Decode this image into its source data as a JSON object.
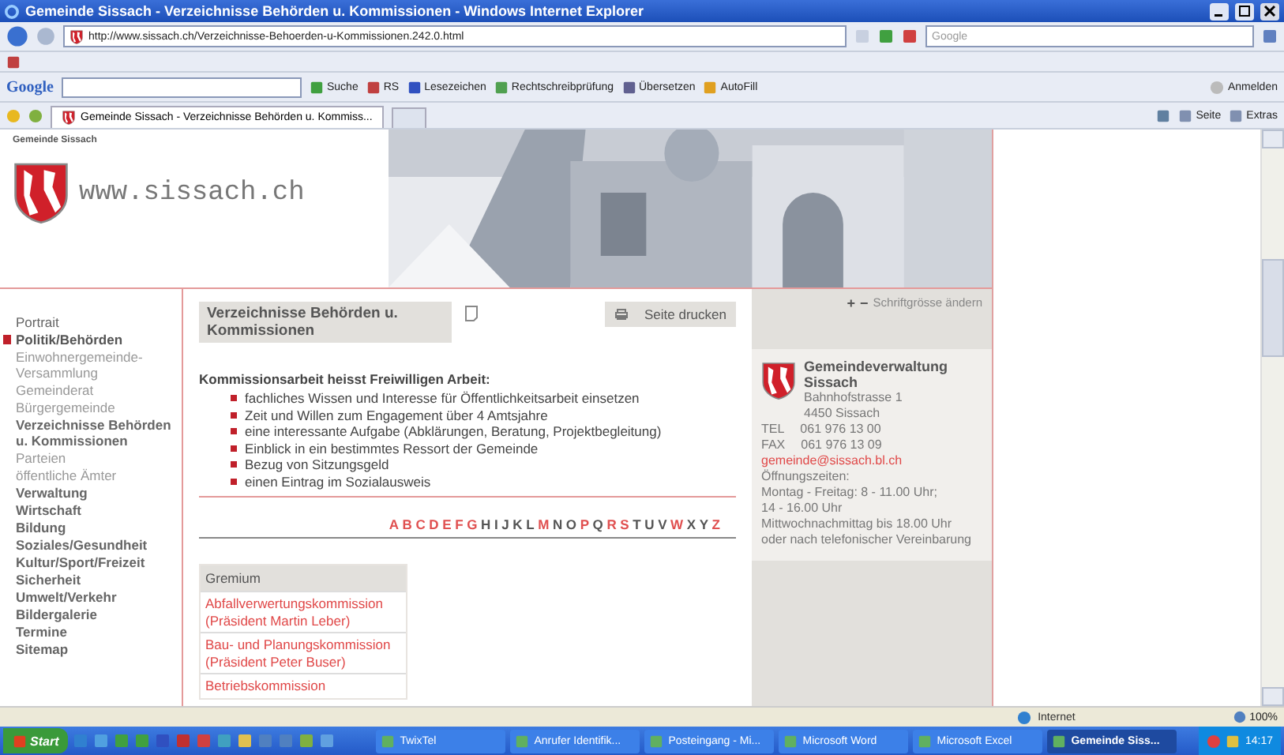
{
  "window": {
    "title": "Gemeinde Sissach - Verzeichnisse Behörden u. Kommissionen - Windows Internet Explorer"
  },
  "address_bar": {
    "url": "http://www.sissach.ch/Verzeichnisse-Behoerden-u-Kommissionen.242.0.html",
    "search_placeholder": "Google"
  },
  "google_toolbar": {
    "logo": "Google",
    "items": [
      "Suche",
      "RS",
      "Lesezeichen",
      "Rechtschreibprüfung",
      "Übersetzen",
      "AutoFill"
    ],
    "sign_in": "Anmelden"
  },
  "tab_bar": {
    "tabs": [
      {
        "label": "Gemeinde Sissach - Verzeichnisse Behörden u. Kommiss...",
        "selected": true
      }
    ],
    "commands": [
      "Seite",
      "Extras"
    ]
  },
  "site": {
    "name": "Gemeinde Sissach",
    "domain": "www.sissach.ch",
    "font_size_label": "Schriftgrösse ändern",
    "font_size_plus": "+",
    "font_size_minus": "−"
  },
  "sidebar": {
    "items": [
      {
        "label": "Portrait",
        "selected": false
      },
      {
        "label": "Politik/Behörden",
        "selected": true,
        "children": [
          {
            "label": "Einwohnergemeinde-Versammlung",
            "selected": false
          },
          {
            "label": "Gemeinderat",
            "selected": false
          },
          {
            "label": "Bürgergemeinde",
            "selected": false
          },
          {
            "label": "Verzeichnisse Behörden u. Kommissionen",
            "selected": true
          },
          {
            "label": "Parteien",
            "selected": false
          },
          {
            "label": "öffentliche Ämter",
            "selected": false
          }
        ]
      },
      {
        "label": "Verwaltung",
        "selected": false
      },
      {
        "label": "Wirtschaft",
        "selected": false
      },
      {
        "label": "Bildung",
        "selected": false
      },
      {
        "label": "Soziales/Gesundheit",
        "selected": false
      },
      {
        "label": "Kultur/Sport/Freizeit",
        "selected": false
      },
      {
        "label": "Sicherheit",
        "selected": false
      },
      {
        "label": "Umwelt/Verkehr",
        "selected": false
      },
      {
        "label": "Bildergalerie",
        "selected": false
      },
      {
        "label": "Termine",
        "selected": false
      },
      {
        "label": "Sitemap",
        "selected": false
      }
    ]
  },
  "content": {
    "heading": "Verzeichnisse Behörden u. Kommissionen",
    "print_button": "Seite drucken",
    "intro": "Kommissionsarbeit heisst Freiwilligen Arbeit:",
    "bullets": [
      "fachliches Wissen und Interesse für Öffentlichkeitsarbeit einsetzen",
      "Zeit und Willen zum Engagement über 4 Amtsjahre",
      "eine interessante Aufgabe (Abklärungen, Beratung, Projektbegleitung)",
      "Einblick in ein bestimmtes Ressort der Gemeinde",
      "Bezug von Sitzungsgeld",
      "einen Eintrag im Sozialausweis"
    ],
    "alphabet": [
      {
        "letter": "A",
        "linked": true
      },
      {
        "letter": "B",
        "linked": true
      },
      {
        "letter": "C",
        "linked": true
      },
      {
        "letter": "D",
        "linked": true
      },
      {
        "letter": "E",
        "linked": true
      },
      {
        "letter": "F",
        "linked": true
      },
      {
        "letter": "G",
        "linked": true
      },
      {
        "letter": "H",
        "linked": false
      },
      {
        "letter": "I",
        "linked": false
      },
      {
        "letter": "J",
        "linked": false
      },
      {
        "letter": "K",
        "linked": false
      },
      {
        "letter": "L",
        "linked": false
      },
      {
        "letter": "M",
        "linked": true
      },
      {
        "letter": "N",
        "linked": false
      },
      {
        "letter": "O",
        "linked": false
      },
      {
        "letter": "P",
        "linked": true
      },
      {
        "letter": "Q",
        "linked": false
      },
      {
        "letter": "R",
        "linked": true
      },
      {
        "letter": "S",
        "linked": true
      },
      {
        "letter": "T",
        "linked": false
      },
      {
        "letter": "U",
        "linked": false
      },
      {
        "letter": "V",
        "linked": false
      },
      {
        "letter": "W",
        "linked": true
      },
      {
        "letter": "X",
        "linked": false
      },
      {
        "letter": "Y",
        "linked": false
      },
      {
        "letter": "Z",
        "linked": true
      }
    ],
    "table": {
      "header": "Gremium",
      "rows": [
        "Abfallverwertungskommission (Präsident Martin Leber)",
        "Bau- und Planungskommission (Präsident Peter Buser)",
        "Betriebskommission"
      ]
    }
  },
  "contact": {
    "name": "Gemeindeverwaltung Sissach",
    "street": "Bahnhofstrasse 1",
    "city": "4450 Sissach",
    "phones": [
      {
        "label": "TEL",
        "number": "061 976 13 00"
      },
      {
        "label": "FAX",
        "number": "061 976 13 09"
      }
    ],
    "email": "gemeinde@sissach.bl.ch",
    "hours_title": "Öffnungszeiten:",
    "hours": [
      "Montag - Freitag: 8 - 11.00 Uhr;",
      "14 - 16.00 Uhr",
      "Mittwochnachmittag bis 18.00 Uhr",
      "oder nach telefonischer Vereinbarung"
    ]
  },
  "status_bar": {
    "zone": "Internet",
    "zoom": "100%"
  },
  "taskbar": {
    "start": "Start",
    "tasks": [
      {
        "label": "TwixTel",
        "selected": false
      },
      {
        "label": "Anrufer Identifik...",
        "selected": false
      },
      {
        "label": "Posteingang - Mi...",
        "selected": false
      },
      {
        "label": "Microsoft Word",
        "selected": false
      },
      {
        "label": "Microsoft Excel",
        "selected": false
      },
      {
        "label": "Gemeinde Siss...",
        "selected": true
      }
    ],
    "clock": "14:17"
  }
}
